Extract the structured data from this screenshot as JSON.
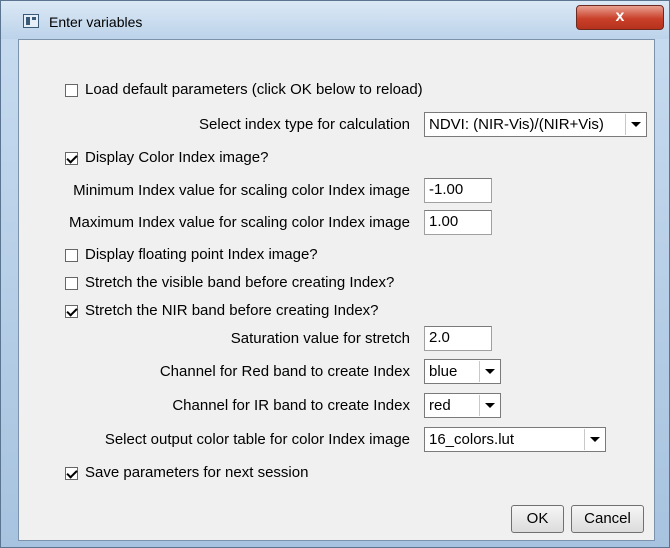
{
  "window": {
    "title": "Enter variables",
    "close_label": "x"
  },
  "load_default": {
    "label": "Load default parameters (click OK below to reload)",
    "checked": false
  },
  "index_type": {
    "label": "Select index type for calculation",
    "value": "NDVI: (NIR-Vis)/(NIR+Vis)"
  },
  "display_color": {
    "label": "Display Color Index image?",
    "checked": true
  },
  "min_index": {
    "label": "Minimum Index value for scaling color Index image",
    "value": "-1.00"
  },
  "max_index": {
    "label": "Maximum Index value for scaling color Index image",
    "value": "1.00"
  },
  "display_float": {
    "label": "Display floating point Index image?",
    "checked": false
  },
  "stretch_visible": {
    "label": "Stretch the visible band before creating Index?",
    "checked": false
  },
  "stretch_nir": {
    "label": "Stretch the NIR band before creating Index?",
    "checked": true
  },
  "saturation": {
    "label": "Saturation value for stretch",
    "value": "2.0"
  },
  "red_channel": {
    "label": "Channel for Red band to create Index",
    "value": "blue"
  },
  "ir_channel": {
    "label": "Channel for IR band to create Index",
    "value": "red"
  },
  "color_table": {
    "label": "Select output color table for color Index image",
    "value": "16_colors.lut"
  },
  "save_params": {
    "label": "Save parameters for next session",
    "checked": true
  },
  "buttons": {
    "ok": "OK",
    "cancel": "Cancel"
  }
}
